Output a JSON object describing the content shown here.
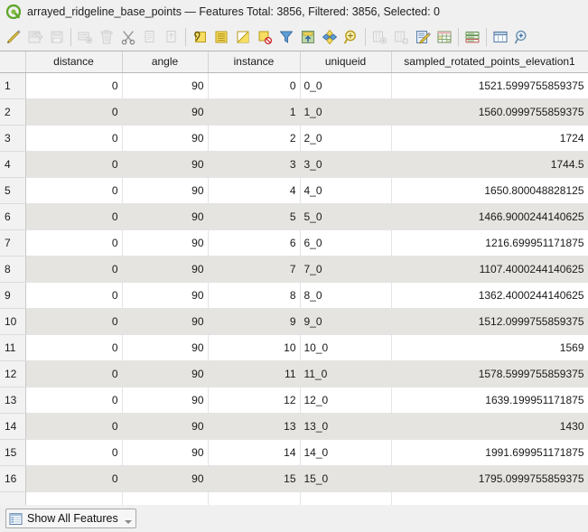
{
  "window": {
    "logo_icon": "qgis-q-icon",
    "title": "arrayed_ridgeline_base_points — Features Total: 3856, Filtered: 3856, Selected: 0",
    "layer_name": "arrayed_ridgeline_base_points",
    "features_total": "3856",
    "features_filtered": "3856",
    "features_selected": "0"
  },
  "toolbar": {
    "buttons": [
      {
        "name": "toggle-editing-icon",
        "label": "Toggle editing mode",
        "enabled": true
      },
      {
        "name": "save-edits-icon",
        "label": "Save edits",
        "enabled": false
      },
      {
        "name": "reload-table-icon",
        "label": "Reload the table",
        "enabled": false
      },
      {
        "name": "add-feature-icon",
        "label": "Add feature",
        "enabled": false
      },
      {
        "name": "delete-selected-icon",
        "label": "Delete selected features",
        "enabled": false
      },
      {
        "name": "cut-features-icon",
        "label": "Cut selected features",
        "enabled": true
      },
      {
        "name": "copy-features-icon",
        "label": "Copy selected features",
        "enabled": false
      },
      {
        "name": "paste-features-icon",
        "label": "Paste features",
        "enabled": false
      },
      {
        "name": "select-by-expression-icon",
        "label": "Select features using an expression",
        "enabled": true
      },
      {
        "name": "select-all-icon",
        "label": "Select all features",
        "enabled": true
      },
      {
        "name": "invert-selection-icon",
        "label": "Invert selection",
        "enabled": true
      },
      {
        "name": "deselect-all-icon",
        "label": "Deselect all features",
        "enabled": true
      },
      {
        "name": "filter-selection-icon",
        "label": "Filter / select features using form",
        "enabled": true
      },
      {
        "name": "move-selection-to-top-icon",
        "label": "Move selection to top",
        "enabled": true
      },
      {
        "name": "pan-map-to-selected-icon",
        "label": "Pan map to selected rows",
        "enabled": true
      },
      {
        "name": "zoom-map-to-selected-icon",
        "label": "Zoom map to selected rows",
        "enabled": true
      },
      {
        "name": "new-field-icon",
        "label": "New field",
        "enabled": false
      },
      {
        "name": "delete-field-icon",
        "label": "Delete field",
        "enabled": false
      },
      {
        "name": "open-field-calculator-icon",
        "label": "Open field calculator",
        "enabled": true
      },
      {
        "name": "conditional-formatting-icon",
        "label": "Conditional formatting",
        "enabled": true
      },
      {
        "name": "organize-columns-icon",
        "label": "Organize columns",
        "enabled": true
      },
      {
        "name": "dock-undock-form-icon",
        "label": "Dock / undock attribute table",
        "enabled": true
      },
      {
        "name": "actions-icon",
        "label": "Actions",
        "enabled": true
      }
    ]
  },
  "table": {
    "columns": [
      "distance",
      "angle",
      "instance",
      "uniqueid",
      "sampled_rotated_points_elevation1"
    ],
    "rows": [
      {
        "num": "1",
        "distance": "0",
        "angle": "90",
        "instance": "0",
        "uniqueid": "0_0",
        "elevation": "1521.5999755859375"
      },
      {
        "num": "2",
        "distance": "0",
        "angle": "90",
        "instance": "1",
        "uniqueid": "1_0",
        "elevation": "1560.0999755859375"
      },
      {
        "num": "3",
        "distance": "0",
        "angle": "90",
        "instance": "2",
        "uniqueid": "2_0",
        "elevation": "1724"
      },
      {
        "num": "4",
        "distance": "0",
        "angle": "90",
        "instance": "3",
        "uniqueid": "3_0",
        "elevation": "1744.5"
      },
      {
        "num": "5",
        "distance": "0",
        "angle": "90",
        "instance": "4",
        "uniqueid": "4_0",
        "elevation": "1650.800048828125"
      },
      {
        "num": "6",
        "distance": "0",
        "angle": "90",
        "instance": "5",
        "uniqueid": "5_0",
        "elevation": "1466.9000244140625"
      },
      {
        "num": "7",
        "distance": "0",
        "angle": "90",
        "instance": "6",
        "uniqueid": "6_0",
        "elevation": "1216.699951171875"
      },
      {
        "num": "8",
        "distance": "0",
        "angle": "90",
        "instance": "7",
        "uniqueid": "7_0",
        "elevation": "1107.4000244140625"
      },
      {
        "num": "9",
        "distance": "0",
        "angle": "90",
        "instance": "8",
        "uniqueid": "8_0",
        "elevation": "1362.4000244140625"
      },
      {
        "num": "10",
        "distance": "0",
        "angle": "90",
        "instance": "9",
        "uniqueid": "9_0",
        "elevation": "1512.0999755859375"
      },
      {
        "num": "11",
        "distance": "0",
        "angle": "90",
        "instance": "10",
        "uniqueid": "10_0",
        "elevation": "1569"
      },
      {
        "num": "12",
        "distance": "0",
        "angle": "90",
        "instance": "11",
        "uniqueid": "11_0",
        "elevation": "1578.5999755859375"
      },
      {
        "num": "13",
        "distance": "0",
        "angle": "90",
        "instance": "12",
        "uniqueid": "12_0",
        "elevation": "1639.199951171875"
      },
      {
        "num": "14",
        "distance": "0",
        "angle": "90",
        "instance": "13",
        "uniqueid": "13_0",
        "elevation": "1430"
      },
      {
        "num": "15",
        "distance": "0",
        "angle": "90",
        "instance": "14",
        "uniqueid": "14_0",
        "elevation": "1991.699951171875"
      },
      {
        "num": "16",
        "distance": "0",
        "angle": "90",
        "instance": "15",
        "uniqueid": "15_0",
        "elevation": "1795.0999755859375"
      }
    ]
  },
  "statusbar": {
    "show_all_icon": "table-list-icon",
    "show_all_label": "Show All Features",
    "caret_icon": "chevron-down-icon"
  },
  "colors": {
    "accent_yellow": "#f2d24b",
    "logo_green": "#5ea62b",
    "window_bg": "#f0f0f0",
    "row_alt_bg": "#e6e4e0"
  }
}
